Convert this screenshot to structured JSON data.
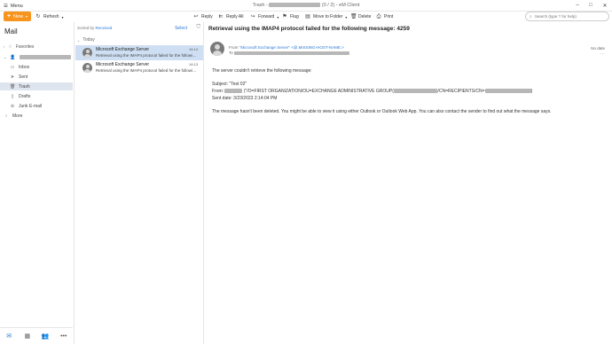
{
  "titlebar": {
    "menu_label": "Menu",
    "title_prefix": "Trash - ",
    "title_suffix": " (0 / 2) - eM Client",
    "controls": [
      "minimize-icon",
      "maximize-icon",
      "close-icon"
    ]
  },
  "toolbar": {
    "new_label": "New",
    "refresh_label": "Refresh",
    "reply_label": "Reply",
    "reply_all_label": "Reply All",
    "forward_label": "Forward",
    "flag_label": "Flag",
    "move_label": "Move to Folder",
    "delete_label": "Delete",
    "print_label": "Print",
    "search_placeholder": "Search (type ? for help)"
  },
  "sidebar": {
    "title": "Mail",
    "favorites_label": "Favorites",
    "folders": [
      {
        "label": "Inbox",
        "icon": "inbox-icon"
      },
      {
        "label": "Sent",
        "icon": "sent-icon"
      },
      {
        "label": "Trash",
        "icon": "trash-icon",
        "selected": true
      },
      {
        "label": "Drafts",
        "icon": "drafts-icon"
      },
      {
        "label": "Junk E-mail",
        "icon": "junk-icon"
      },
      {
        "label": "More",
        "icon": "chevron-right-icon"
      }
    ]
  },
  "bottom_nav": [
    "mail-icon",
    "calendar-icon",
    "contacts-icon",
    "more-icon"
  ],
  "message_list": {
    "sort_prefix": "Sorted by ",
    "sort_value": "Received",
    "select_label": "Select",
    "group_label": "Today",
    "messages": [
      {
        "from": "Microsoft Exchange Server",
        "time": "14:14",
        "preview": "Retrieval using the IMAP4 protocol failed for the following message: 4259",
        "selected": true
      },
      {
        "from": "Microsoft Exchange Server",
        "time": "14:13",
        "preview": "Retrieval using the IMAP4 protocol failed for the following message: 4258",
        "selected": false
      }
    ]
  },
  "reading": {
    "subject": "Retrieval using the IMAP4 protocol failed for the following message: 4259",
    "from_prefix": "From ",
    "from_name": "\"Microsoft Exchange Server\" <@.MISSING-HOST-NAME.>",
    "to_prefix": "To ",
    "date": "No date",
    "body": {
      "line1": "The server couldn't retrieve the following message:",
      "subject_line": "Subject: \"Test 02\"",
      "from_label": "From: ",
      "from_mid": " (\"/O=FIRST ORGANIZATION/OU=EXCHANGE ADMINISTRATIVE GROUP(",
      "from_mid2": ")/CN=RECIPIENTS/CN=",
      "from_end": ")",
      "sent_date": "Sent date: 3/23/2023 2:14:04 PM",
      "closing": "The message hasn't been deleted. You might be able to view it using either Outlook or Outlook Web App. You can also contact the sender to find out what the message says."
    }
  }
}
